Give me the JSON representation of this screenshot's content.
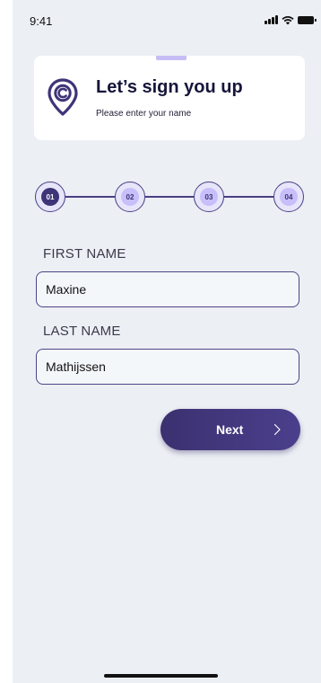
{
  "status_bar": {
    "time": "9:41"
  },
  "header": {
    "title": "Let’s sign you up",
    "subtitle": "Please enter your name"
  },
  "stepper": {
    "steps": [
      "01",
      "02",
      "03",
      "04"
    ],
    "active_step": "01"
  },
  "form": {
    "first_name": {
      "label": "FIRST NAME",
      "value": "Maxine"
    },
    "last_name": {
      "label": "LAST NAME",
      "value": "Mathijssen"
    }
  },
  "actions": {
    "next_label": "Next"
  },
  "colors": {
    "primary": "#3e3478",
    "step_fill": "#c8befa",
    "background": "#eceff4",
    "accent_tab": "#c6bdf6"
  }
}
